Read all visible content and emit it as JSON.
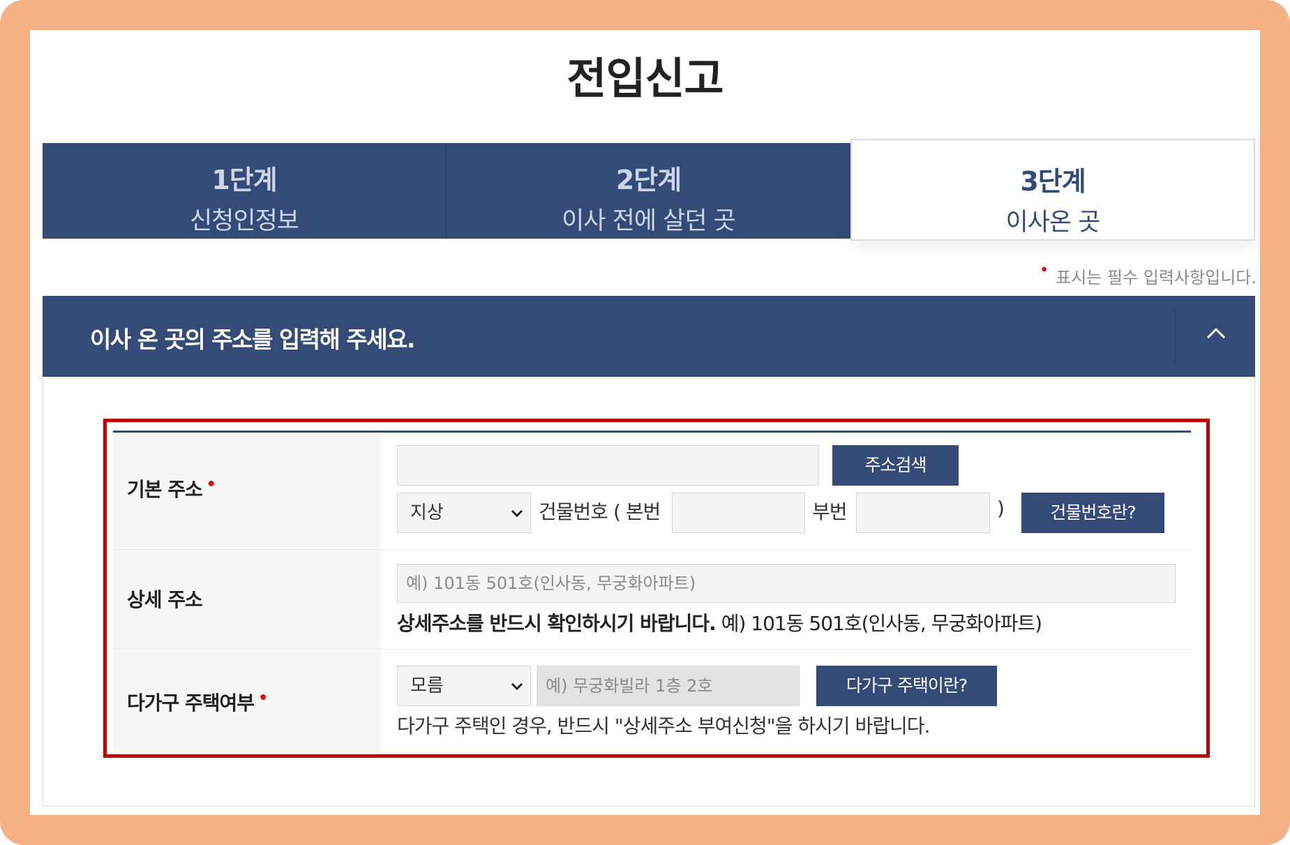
{
  "page": {
    "title": "전입신고"
  },
  "steps": [
    {
      "number": "1단계",
      "name": "신청인정보",
      "active": false
    },
    {
      "number": "2단계",
      "name": "이사 전에 살던 곳",
      "active": false
    },
    {
      "number": "3단계",
      "name": "이사온 곳",
      "active": true
    }
  ],
  "required_note": {
    "dot": "•",
    "text": "표시는 필수 입력사항입니다."
  },
  "section": {
    "title": "이사 온 곳의 주소를 입력해 주세요."
  },
  "form": {
    "basic_address": {
      "label": "기본 주소",
      "required_dot": "•",
      "address_value": "",
      "search_button": "주소검색",
      "ground_select": "지상",
      "building_number_prefix": "건물번호 ( 본번",
      "main_number_value": "",
      "sub_number_label": "부번",
      "sub_number_value": "",
      "close_paren": ")",
      "building_number_help_button": "건물번호란?"
    },
    "detail_address": {
      "label": "상세 주소",
      "placeholder": "예) 101동 501호(인사동, 무궁화아파트)",
      "notice_bold": "상세주소를 반드시 확인하시기 바랍니다.",
      "notice_example": "예) 101동 501호(인사동, 무궁화아파트)"
    },
    "multi_household": {
      "label": "다가구 주택여부",
      "required_dot": "•",
      "select_value": "모름",
      "placeholder": "예) 무궁화빌라 1층 2호",
      "help_button": "다가구 주택이란?",
      "notice": "다가구 주택인 경우, 반드시 \"상세주소 부여신청\"을 하시기 바랍니다."
    }
  },
  "colors": {
    "navy": "#344b77",
    "frame": "#f4b183",
    "highlight_border": "#c00000",
    "required": "#e60012"
  },
  "icons": {
    "collapse": "chevron-up-icon",
    "select_arrow": "chevron-down-icon"
  }
}
